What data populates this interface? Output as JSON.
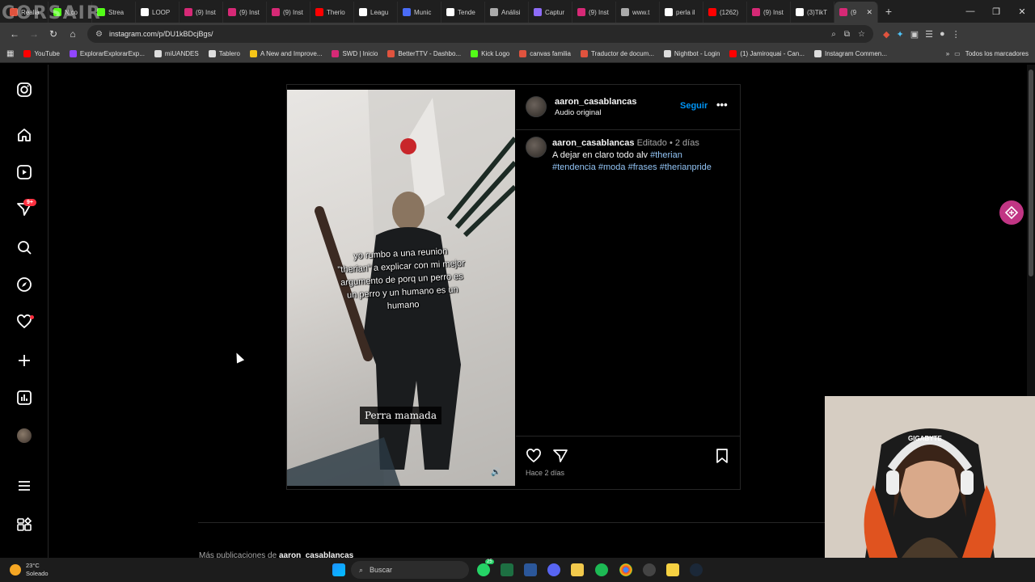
{
  "browser": {
    "tabs": [
      {
        "label": "Realia",
        "color": "#e0533e"
      },
      {
        "label": "Nico",
        "color": "#53fc18"
      },
      {
        "label": "Strea",
        "color": "#53fc18"
      },
      {
        "label": "LOOP",
        "color": "#ffffff"
      },
      {
        "label": "(9) Inst",
        "color": "#d62976"
      },
      {
        "label": "(9) Inst",
        "color": "#d62976"
      },
      {
        "label": "(9) Inst",
        "color": "#d62976"
      },
      {
        "label": "Therio",
        "color": "#ff0000"
      },
      {
        "label": "Leagu",
        "color": "#ffffff"
      },
      {
        "label": "Munic",
        "color": "#4a6cf7"
      },
      {
        "label": "Tende",
        "color": "#ffffff"
      },
      {
        "label": "Análisi",
        "color": "#aaaaaa"
      },
      {
        "label": "Captur",
        "color": "#8e6cf7"
      },
      {
        "label": "(9) Inst",
        "color": "#d62976"
      },
      {
        "label": "www.t",
        "color": "#aaaaaa"
      },
      {
        "label": "perla il",
        "color": "#ffffff"
      },
      {
        "label": "(1262)",
        "color": "#ff0000"
      },
      {
        "label": "(9) Inst",
        "color": "#d62976"
      },
      {
        "label": "(3)TikT",
        "color": "#ffffff"
      },
      {
        "label": "(9",
        "color": "#d62976",
        "active": true
      }
    ],
    "watermark": "CORSAIR",
    "url": "instagram.com/p/DU1kBDcjBgs/",
    "bookmarks": [
      {
        "label": "YouTube",
        "color": "#ff0000"
      },
      {
        "label": "ExplorarExplorarExp...",
        "color": "#9146ff"
      },
      {
        "label": "miUANDES",
        "color": "#dddddd"
      },
      {
        "label": "Tablero",
        "color": "#dddddd"
      },
      {
        "label": "A New and Improve...",
        "color": "#f5c518"
      },
      {
        "label": "SWD | Inicio",
        "color": "#d62976"
      },
      {
        "label": "BetterTTV - Dashbo...",
        "color": "#e0533e"
      },
      {
        "label": "Kick Logo",
        "color": "#53fc18"
      },
      {
        "label": "canvas familia",
        "color": "#e0533e"
      },
      {
        "label": "Traductor de docum...",
        "color": "#e0533e"
      },
      {
        "label": "Nightbot - Login",
        "color": "#dddddd"
      },
      {
        "label": "(1) Jamiroquai - Can...",
        "color": "#ff0000"
      },
      {
        "label": "Instagram Commen...",
        "color": "#dddddd"
      }
    ],
    "all_bookmarks": "Todos los marcadores"
  },
  "sidebar": {
    "notification_badge": "9+"
  },
  "post": {
    "username": "aaron_casablancas",
    "audio": "Audio original",
    "follow_label": "Seguir",
    "more_label": "•••",
    "comment": {
      "username": "aaron_casablancas",
      "edited": "Editado",
      "separator": "•",
      "time": "2 días",
      "text": "A dejar en claro todo alv",
      "tags_line1": "#therian",
      "tags_line2": "#tendencia #moda #frases #therianpride"
    },
    "video_caption": "yo rumbo a una reunion \"therian\" a explicar con mi mejor argumento  de porq un perro es un perro y un humano es un humano",
    "subtitle": "Perra mamada",
    "posted_ago": "Hace 2 días"
  },
  "more_posts": {
    "prefix": "Más publicaciones de",
    "username": "aaron_casablancas"
  },
  "webcam": {
    "brand": "GIGABYTE"
  },
  "taskbar": {
    "temperature": "23°C",
    "condition": "Soleado",
    "search_placeholder": "Buscar",
    "tray_badge": "25"
  }
}
